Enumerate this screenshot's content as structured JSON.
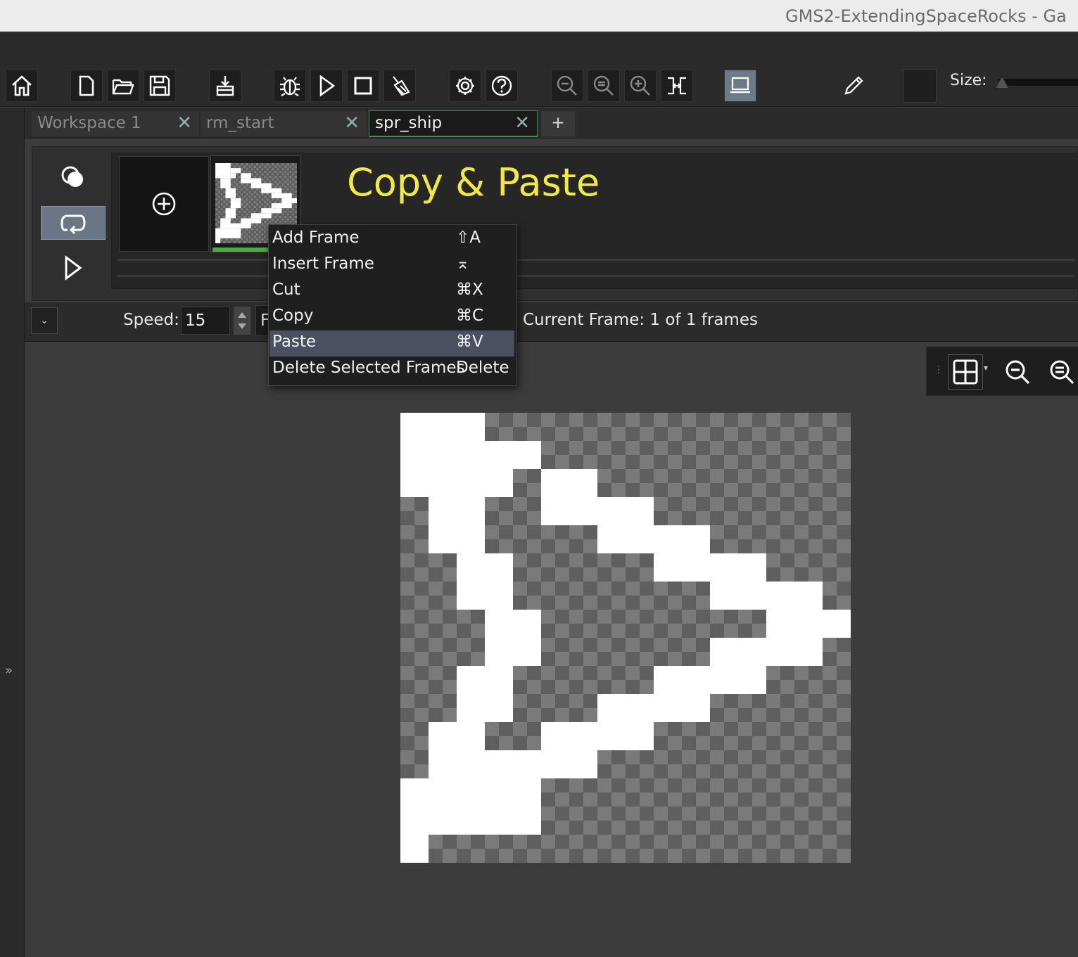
{
  "window": {
    "title": "GMS2-ExtendingSpaceRocks - Ga"
  },
  "toolbar": {
    "buttons": [
      {
        "name": "home-icon"
      },
      {
        "name": "new-file-icon"
      },
      {
        "name": "open-folder-icon"
      },
      {
        "name": "save-icon"
      },
      {
        "name": "create-executable-icon"
      },
      {
        "name": "debug-icon"
      },
      {
        "name": "run-icon"
      },
      {
        "name": "stop-icon"
      },
      {
        "name": "clean-icon"
      },
      {
        "name": "settings-icon"
      },
      {
        "name": "help-icon"
      },
      {
        "name": "zoom-out-icon"
      },
      {
        "name": "zoom-reset-icon"
      },
      {
        "name": "zoom-in-icon"
      },
      {
        "name": "fit-icon"
      },
      {
        "name": "device-icon"
      }
    ],
    "size_label": "Size:"
  },
  "tabs": [
    {
      "label": "Workspace 1",
      "active": false
    },
    {
      "label": "rm_start",
      "active": false
    },
    {
      "label": "spr_ship",
      "active": true
    }
  ],
  "tab_add_label": "+",
  "heading": "Copy & Paste",
  "speed": {
    "label": "Speed:",
    "value": "15",
    "fps_text": "F"
  },
  "current_frame": "Current Frame: 1 of 1 frames",
  "context_menu": {
    "items": [
      {
        "label": "Add Frame",
        "shortcut": "⇧A",
        "selected": false
      },
      {
        "label": "Insert Frame",
        "shortcut": "⌅",
        "selected": false
      },
      {
        "label": "Cut",
        "shortcut": "⌘X",
        "selected": false
      },
      {
        "label": "Copy",
        "shortcut": "⌘C",
        "selected": false
      },
      {
        "label": "Paste",
        "shortcut": "⌘V",
        "selected": true
      },
      {
        "label": "Delete Selected Frames",
        "shortcut": "Delete",
        "selected": false
      }
    ]
  },
  "colors": {
    "accent_green": "#4fa94f",
    "heading_yellow": "#f3ea3d",
    "menu_selected": "#4a5060"
  }
}
